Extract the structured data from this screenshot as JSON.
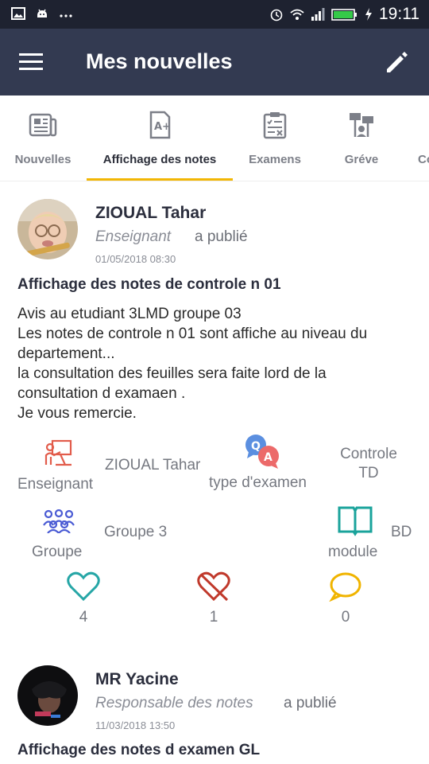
{
  "status_bar": {
    "time": "19:11",
    "icons": [
      "image-icon",
      "android-icon",
      "more-dots-icon",
      "alarm-icon",
      "wifi-icon",
      "signal-icon",
      "battery-icon",
      "charging-icon"
    ]
  },
  "app_bar": {
    "title": "Mes nouvelles",
    "left_icon": "menu-icon",
    "right_icon": "edit-icon"
  },
  "tabs": [
    {
      "label": "Nouvelles",
      "icon": "newspaper-icon",
      "active": false
    },
    {
      "label": "Affichage des notes",
      "icon": "grade-document-icon",
      "active": true
    },
    {
      "label": "Examens",
      "icon": "exam-clipboard-icon",
      "active": false
    },
    {
      "label": "Gréve",
      "icon": "strike-icon",
      "active": false
    },
    {
      "label": "Co",
      "icon": "",
      "active": false
    }
  ],
  "colors": {
    "app_bar": "#333a51",
    "status_bar": "#1e2230",
    "tab_indicator": "#f2b705",
    "like": "#26a6a6",
    "dislike": "#c0392b",
    "comment": "#f0b400",
    "teacher_icon": "#e25c4b",
    "group_icon": "#4a5bd4",
    "module_icon": "#1aa39b"
  },
  "posts": [
    {
      "author": "ZIOUAL Tahar",
      "role": "Enseignant",
      "action": "a publié",
      "date": "01/05/2018 08:30",
      "title": "Affichage des notes de controle n 01",
      "body": [
        "Avis au etudiant  3LMD groupe 03",
        "Les notes de controle n 01 sont affiche au niveau du",
        "departement...",
        "la consultation des feuilles sera faite lord de la",
        "consultation d examaen .",
        "Je vous remercie."
      ],
      "meta": {
        "teacher_label": "Enseignant",
        "teacher_value": "ZIOUAL Tahar",
        "exam_type_label": "type d'examen",
        "exam_type_value_line1": "Controle",
        "exam_type_value_line2": "TD",
        "group_label": "Groupe",
        "group_value": "Groupe 3",
        "module_label": "module",
        "module_value": "BD"
      },
      "reactions": {
        "likes": "4",
        "dislikes": "1",
        "comments": "0"
      }
    },
    {
      "author": "MR Yacine",
      "role": "Responsable des notes",
      "action": "a publié",
      "date": "11/03/2018 13:50",
      "title": "Affichage des notes d examen GL"
    }
  ]
}
